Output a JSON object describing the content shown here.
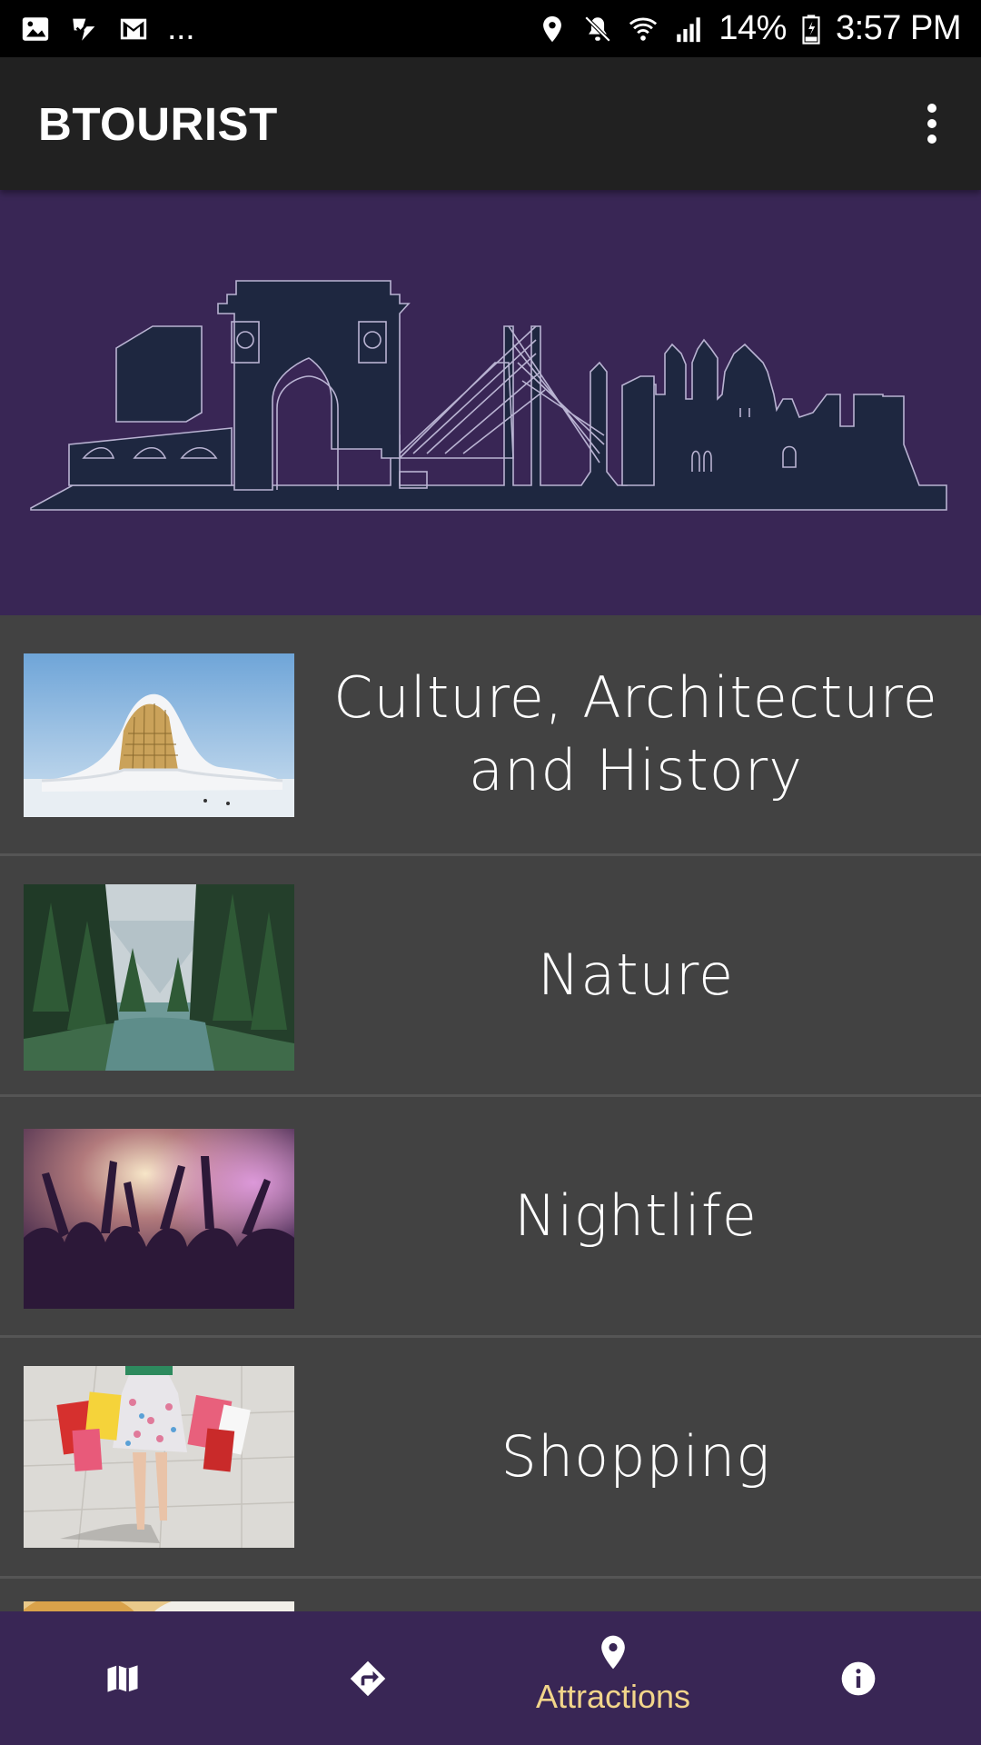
{
  "status_bar": {
    "battery": "14%",
    "time": "3:57 PM",
    "overflow_indicator": "...",
    "left_icons": [
      "image-icon",
      "task-check-icon",
      "gmail-icon"
    ],
    "right_icons": [
      "location-icon",
      "mute-icon",
      "wifi-icon",
      "signal-icon",
      "battery-icon"
    ]
  },
  "app_bar": {
    "title": "BTOURIST",
    "overflow_icon": "more-vert-icon"
  },
  "banner": {
    "image": "city-skyline-illustration"
  },
  "categories": [
    {
      "label": "Culture, Architecture and History",
      "thumb": "modern-building-photo"
    },
    {
      "label": "Nature",
      "thumb": "forest-river-photo"
    },
    {
      "label": "Nightlife",
      "thumb": "concert-crowd-photo"
    },
    {
      "label": "Shopping",
      "thumb": "shopping-bags-photo"
    },
    {
      "label": "",
      "thumb": "food-photo"
    }
  ],
  "bottom_nav": {
    "items": [
      {
        "icon": "map-icon",
        "label": ""
      },
      {
        "icon": "directions-icon",
        "label": ""
      },
      {
        "icon": "place-icon",
        "label": "Attractions",
        "active": true
      },
      {
        "icon": "info-icon",
        "label": ""
      }
    ],
    "active_color": "#f2d58a"
  },
  "colors": {
    "app_bar": "#212121",
    "banner": "#392655",
    "list_bg": "#424242",
    "skyline": "#1e2740"
  }
}
